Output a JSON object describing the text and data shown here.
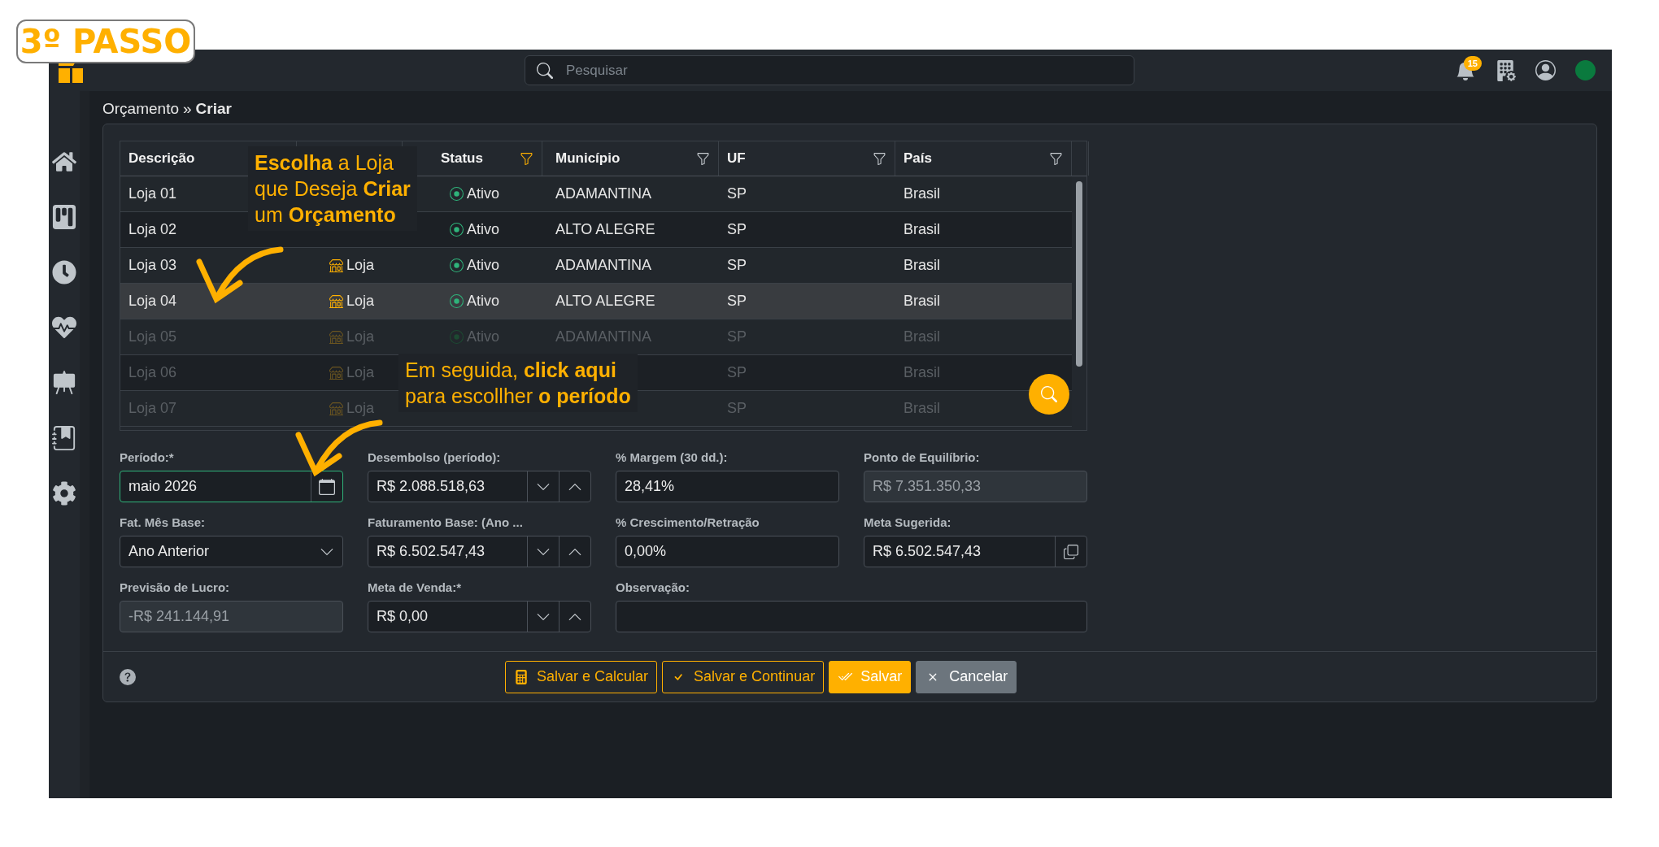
{
  "step_badge": "3º PASSO",
  "top_bar": {
    "search": {
      "placeholder": "Pesquisar"
    },
    "notifications": "15",
    "status_dot": {
      "color": "#0a7a3e"
    }
  },
  "sidebar": {
    "items": [
      {
        "kind": "home"
      },
      {
        "kind": "kanban"
      },
      {
        "kind": "clock"
      },
      {
        "kind": "health"
      },
      {
        "kind": "easel"
      },
      {
        "kind": "journal"
      },
      {
        "kind": "settings"
      }
    ]
  },
  "breadcrumb": {
    "parent": "Orçamento",
    "separator": "»",
    "current": "Criar"
  },
  "table": {
    "columns": [
      {
        "label": "Descrição"
      },
      {},
      {
        "label": "Status",
        "filter_active": true
      },
      {
        "label": "Município",
        "filter_active": false
      },
      {
        "label": "UF",
        "filter_active": false
      },
      {
        "label": "País",
        "filter_active": false
      }
    ],
    "rows": [
      {
        "description": "Loja 01",
        "status": "Ativo",
        "city": "ADAMANTINA",
        "uf": "SP",
        "country": "Brasil",
        "selected": false,
        "dimmed": false
      },
      {
        "description": "Loja 02",
        "status": "Ativo",
        "city": "ALTO ALEGRE",
        "uf": "SP",
        "country": "Brasil",
        "selected": false,
        "dimmed": false
      },
      {
        "description": "Loja 03",
        "type": "Loja",
        "status": "Ativo",
        "city": "ADAMANTINA",
        "uf": "SP",
        "country": "Brasil",
        "selected": false,
        "dimmed": false
      },
      {
        "description": "Loja 04",
        "type": "Loja",
        "status": "Ativo",
        "city": "ALTO ALEGRE",
        "uf": "SP",
        "country": "Brasil",
        "selected": true,
        "dimmed": false
      },
      {
        "description": "Loja 05",
        "type": "Loja",
        "status": "Ativo",
        "city": "ADAMANTINA",
        "uf": "SP",
        "country": "Brasil",
        "selected": false,
        "dimmed": true
      },
      {
        "description": "Loja 06",
        "type": "Loja",
        "uf": "SP",
        "country": "Brasil",
        "selected": false,
        "dimmed": true
      },
      {
        "description": "Loja 07",
        "type": "Loja",
        "uf": "SP",
        "country": "Brasil",
        "selected": false,
        "dimmed": true
      }
    ]
  },
  "form": {
    "fields": [
      {
        "label": "Período:*",
        "kind": "date",
        "value": "maio 2026",
        "focused": true,
        "disabled": false
      },
      {
        "label": "Desembolso (período):",
        "kind": "spinner",
        "value": "R$ 2.088.518,63",
        "focused": false,
        "disabled": false
      },
      {
        "label": "% Margem (30 dd.):",
        "kind": "text",
        "value": "28,41%",
        "focused": false,
        "disabled": false
      },
      {
        "label": "Ponto de Equilíbrio:",
        "kind": "text",
        "value": "R$ 7.351.350,33",
        "focused": false,
        "disabled": true
      },
      {
        "label": "Fat. Mês Base:",
        "kind": "select",
        "value": "Ano Anterior",
        "focused": false,
        "disabled": false
      },
      {
        "label": "Faturamento Base: (Ano ...",
        "kind": "spinner",
        "value": "R$ 6.502.547,43",
        "focused": false,
        "disabled": false
      },
      {
        "label": "% Crescimento/Retração",
        "kind": "text",
        "value": "0,00%",
        "focused": false,
        "disabled": false
      },
      {
        "label": "Meta Sugerida:",
        "kind": "copy",
        "value": "R$ 6.502.547,43",
        "focused": false,
        "disabled": false
      },
      {
        "label": "Previsão de Lucro:",
        "kind": "text",
        "value": "-R$ 241.144,91",
        "focused": false,
        "disabled": true
      },
      {
        "label": "Meta de Venda:*",
        "kind": "spinner",
        "value": "R$ 0,00",
        "focused": false,
        "disabled": false
      },
      {
        "label": "Observação:",
        "kind": "note",
        "focused": false,
        "disabled": false
      }
    ]
  },
  "footer": {
    "buttons": [
      {
        "label": "Salvar e Calcular",
        "kind": "calculate"
      },
      {
        "label": "Salvar e Continuar",
        "kind": "continue"
      },
      {
        "label": "Salvar",
        "kind": "save"
      },
      {
        "label": "Cancelar",
        "kind": "cancel"
      }
    ]
  },
  "callouts": [
    {
      "lines": [
        "**Escolha** a Loja",
        "que Deseja **Criar**",
        "um **Orçamento**"
      ]
    },
    {
      "lines": [
        "Em seguida, **click aqui**",
        "para escollher **o período**"
      ]
    }
  ]
}
